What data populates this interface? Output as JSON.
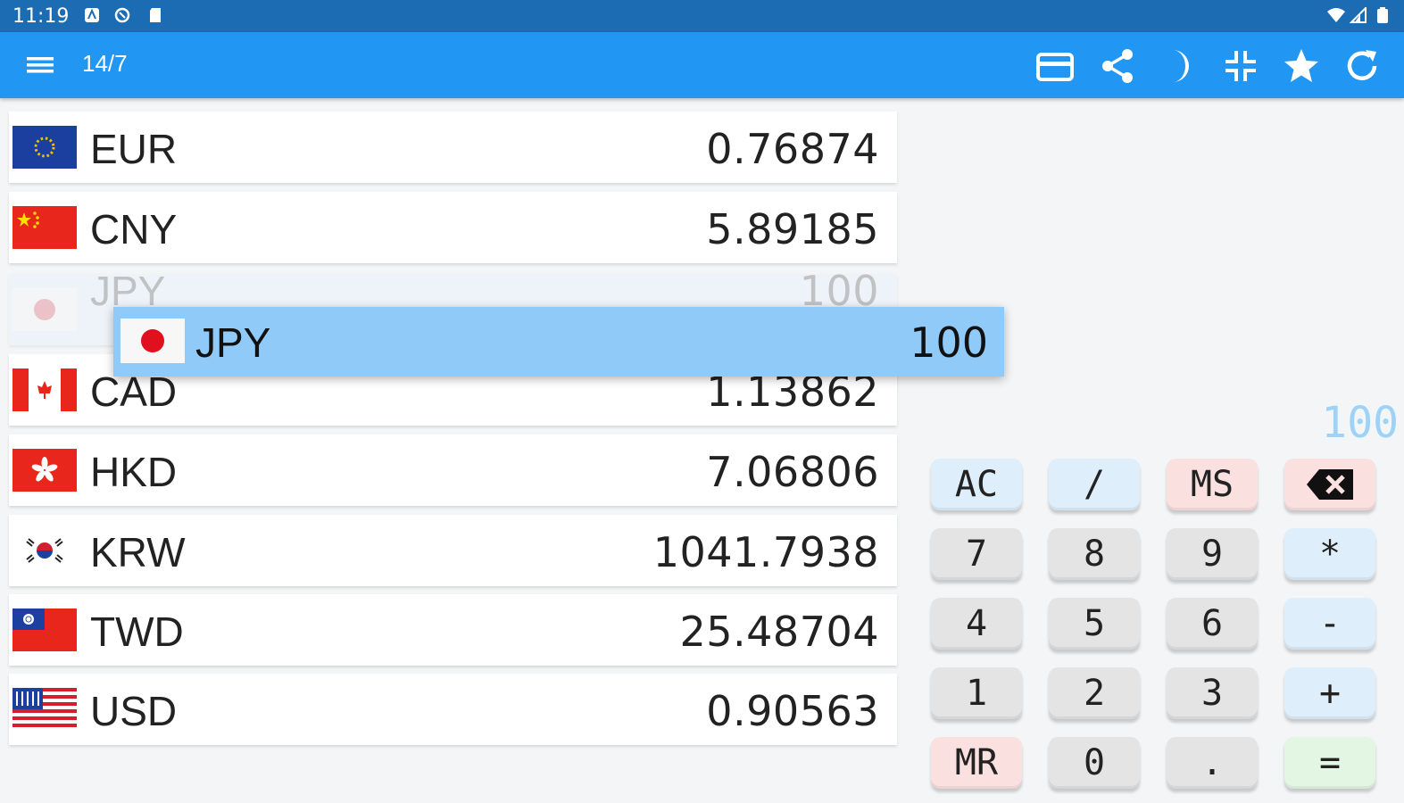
{
  "status": {
    "time": "11:19"
  },
  "app": {
    "title": "14/7",
    "actions": [
      {
        "name": "card-icon"
      },
      {
        "name": "share-icon"
      },
      {
        "name": "moon-icon"
      },
      {
        "name": "compress-icon"
      },
      {
        "name": "star-icon"
      },
      {
        "name": "refresh-icon"
      }
    ]
  },
  "currencies": [
    {
      "code": "EUR",
      "value": "0.76874"
    },
    {
      "code": "CNY",
      "value": "5.89185"
    },
    {
      "code": "JPY",
      "value": "100"
    },
    {
      "code": "CAD",
      "value": "1.13862"
    },
    {
      "code": "HKD",
      "value": "7.06806"
    },
    {
      "code": "KRW",
      "value": "1041.7938"
    },
    {
      "code": "TWD",
      "value": "25.48704"
    },
    {
      "code": "USD",
      "value": "0.90563"
    }
  ],
  "dragging": {
    "code": "JPY",
    "value": "100"
  },
  "display": "100",
  "keypad": {
    "ac": "AC",
    "div": "/",
    "ms": "MS",
    "k7": "7",
    "k8": "8",
    "k9": "9",
    "mul": "*",
    "k4": "4",
    "k5": "5",
    "k6": "6",
    "sub": "-",
    "k1": "1",
    "k2": "2",
    "k3": "3",
    "add": "+",
    "mr": "MR",
    "k0": "0",
    "dot": ".",
    "eq": "="
  },
  "colors": {
    "status_bar": "#1c6cb3",
    "app_bar": "#2196f3",
    "drag_row": "#90caf9"
  }
}
